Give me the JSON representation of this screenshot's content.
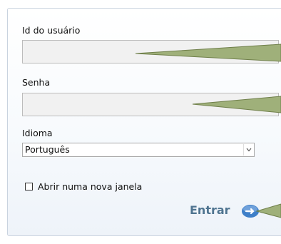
{
  "login": {
    "user_id_label": "Id do usuário",
    "user_id_value": "",
    "password_label": "Senha",
    "password_value": "",
    "language_label": "Idioma",
    "language_selected": "Português",
    "new_window_label": "Abrir numa nova janela",
    "new_window_checked": false,
    "submit_label": "Entrar"
  },
  "colors": {
    "panel_border": "#c9d3df",
    "field_background": "#f1f1f1",
    "submit_text": "#4f7490",
    "submit_icon": "#3f7fc8",
    "callout_fill": "#9fb07a"
  },
  "icons": {
    "submit": "arrow-circle-icon",
    "select": "chevron-down-icon"
  }
}
